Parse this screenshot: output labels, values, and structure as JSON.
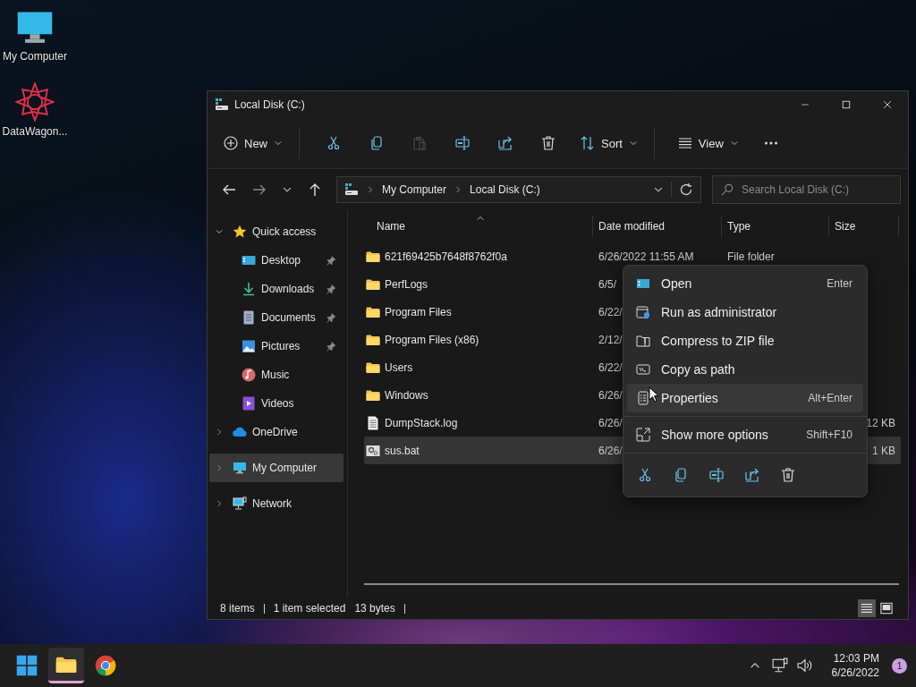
{
  "desktop_icons": [
    {
      "label": "My Computer",
      "kind": "computer"
    },
    {
      "label": "DataWagon...",
      "kind": "app"
    }
  ],
  "window": {
    "title": "Local Disk (C:)",
    "toolbar": [
      {
        "kind": "new",
        "label": "New",
        "disabled": false
      },
      {
        "kind": "cut",
        "disabled": false
      },
      {
        "kind": "copy",
        "disabled": false
      },
      {
        "kind": "paste",
        "disabled": true
      },
      {
        "kind": "rename",
        "disabled": false
      },
      {
        "kind": "share",
        "disabled": false
      },
      {
        "kind": "delete",
        "disabled": false
      },
      {
        "kind": "sort",
        "label": "Sort",
        "disabled": false
      },
      {
        "kind": "view",
        "label": "View",
        "disabled": false
      },
      {
        "kind": "more",
        "disabled": false
      }
    ],
    "address": {
      "segments": [
        "My Computer",
        "Local Disk (C:)"
      ]
    },
    "search": {
      "placeholder": "Search Local Disk (C:)"
    },
    "sidebar": [
      {
        "label": "Quick access",
        "kind": "star",
        "expanded": true,
        "selected": false,
        "children": [
          {
            "label": "Desktop",
            "kind": "desktop",
            "pinned": true,
            "selected": false
          },
          {
            "label": "Downloads",
            "kind": "download",
            "pinned": true,
            "selected": false
          },
          {
            "label": "Documents",
            "kind": "document",
            "pinned": true,
            "selected": false
          },
          {
            "label": "Pictures",
            "kind": "pictures",
            "pinned": true,
            "selected": false
          },
          {
            "label": "Music",
            "kind": "music",
            "pinned": false,
            "selected": false
          },
          {
            "label": "Videos",
            "kind": "videos",
            "pinned": false,
            "selected": false
          }
        ]
      },
      {
        "label": "OneDrive",
        "kind": "cloud",
        "expanded": false,
        "selected": false
      },
      {
        "label": "My Computer",
        "kind": "computer",
        "expanded": false,
        "selected": true
      },
      {
        "label": "Network",
        "kind": "network",
        "expanded": false,
        "selected": false
      }
    ],
    "columns": [
      "Name",
      "Date modified",
      "Type",
      "Size"
    ],
    "rows": [
      {
        "kind": "folder",
        "name": "621f69425b7648f8762f0a",
        "date": "6/26/2022 11:55 AM",
        "type": "File folder",
        "selected": false
      },
      {
        "kind": "folder",
        "name": "PerfLogs",
        "date": "6/5/",
        "selected": false
      },
      {
        "kind": "folder",
        "name": "Program Files",
        "date": "6/22/",
        "selected": false
      },
      {
        "kind": "folder",
        "name": "Program Files (x86)",
        "date": "2/12/",
        "selected": false
      },
      {
        "kind": "folder",
        "name": "Users",
        "date": "6/22/",
        "selected": false
      },
      {
        "kind": "folder",
        "name": "Windows",
        "date": "6/26/",
        "selected": false
      },
      {
        "kind": "log",
        "name": "DumpStack.log",
        "date": "6/26/",
        "size": "12 KB",
        "selected": false
      },
      {
        "kind": "bat",
        "name": "sus.bat",
        "date": "6/26/",
        "size": "1 KB",
        "selected": true
      }
    ],
    "context_menu": {
      "items": [
        {
          "kind": "open",
          "label": "Open",
          "shortcut": "Enter",
          "highlighted": false
        },
        {
          "kind": "admin",
          "label": "Run as administrator",
          "highlighted": false
        },
        {
          "kind": "zip",
          "label": "Compress to ZIP file",
          "highlighted": false
        },
        {
          "kind": "path",
          "label": "Copy as path",
          "highlighted": false
        },
        {
          "kind": "properties",
          "label": "Properties",
          "shortcut": "Alt+Enter",
          "highlighted": true
        }
      ],
      "more": {
        "label": "Show more options",
        "shortcut": "Shift+F10"
      },
      "actions": [
        {
          "kind": "cut"
        },
        {
          "kind": "copy"
        },
        {
          "kind": "rename"
        },
        {
          "kind": "share"
        },
        {
          "kind": "delete"
        }
      ]
    },
    "status_bar": {
      "count": "8 items",
      "selection": "1 item selected",
      "size": "13 bytes",
      "views": [
        {
          "kind": "details",
          "selected": true
        },
        {
          "kind": "preview",
          "selected": false
        }
      ]
    }
  },
  "taskbar": {
    "apps": [
      {
        "kind": "start",
        "running": false
      },
      {
        "kind": "explorer",
        "running": true
      },
      {
        "kind": "chrome",
        "running": false
      }
    ],
    "time": "12:03 PM",
    "date": "6/26/2022",
    "notifications": "1"
  }
}
